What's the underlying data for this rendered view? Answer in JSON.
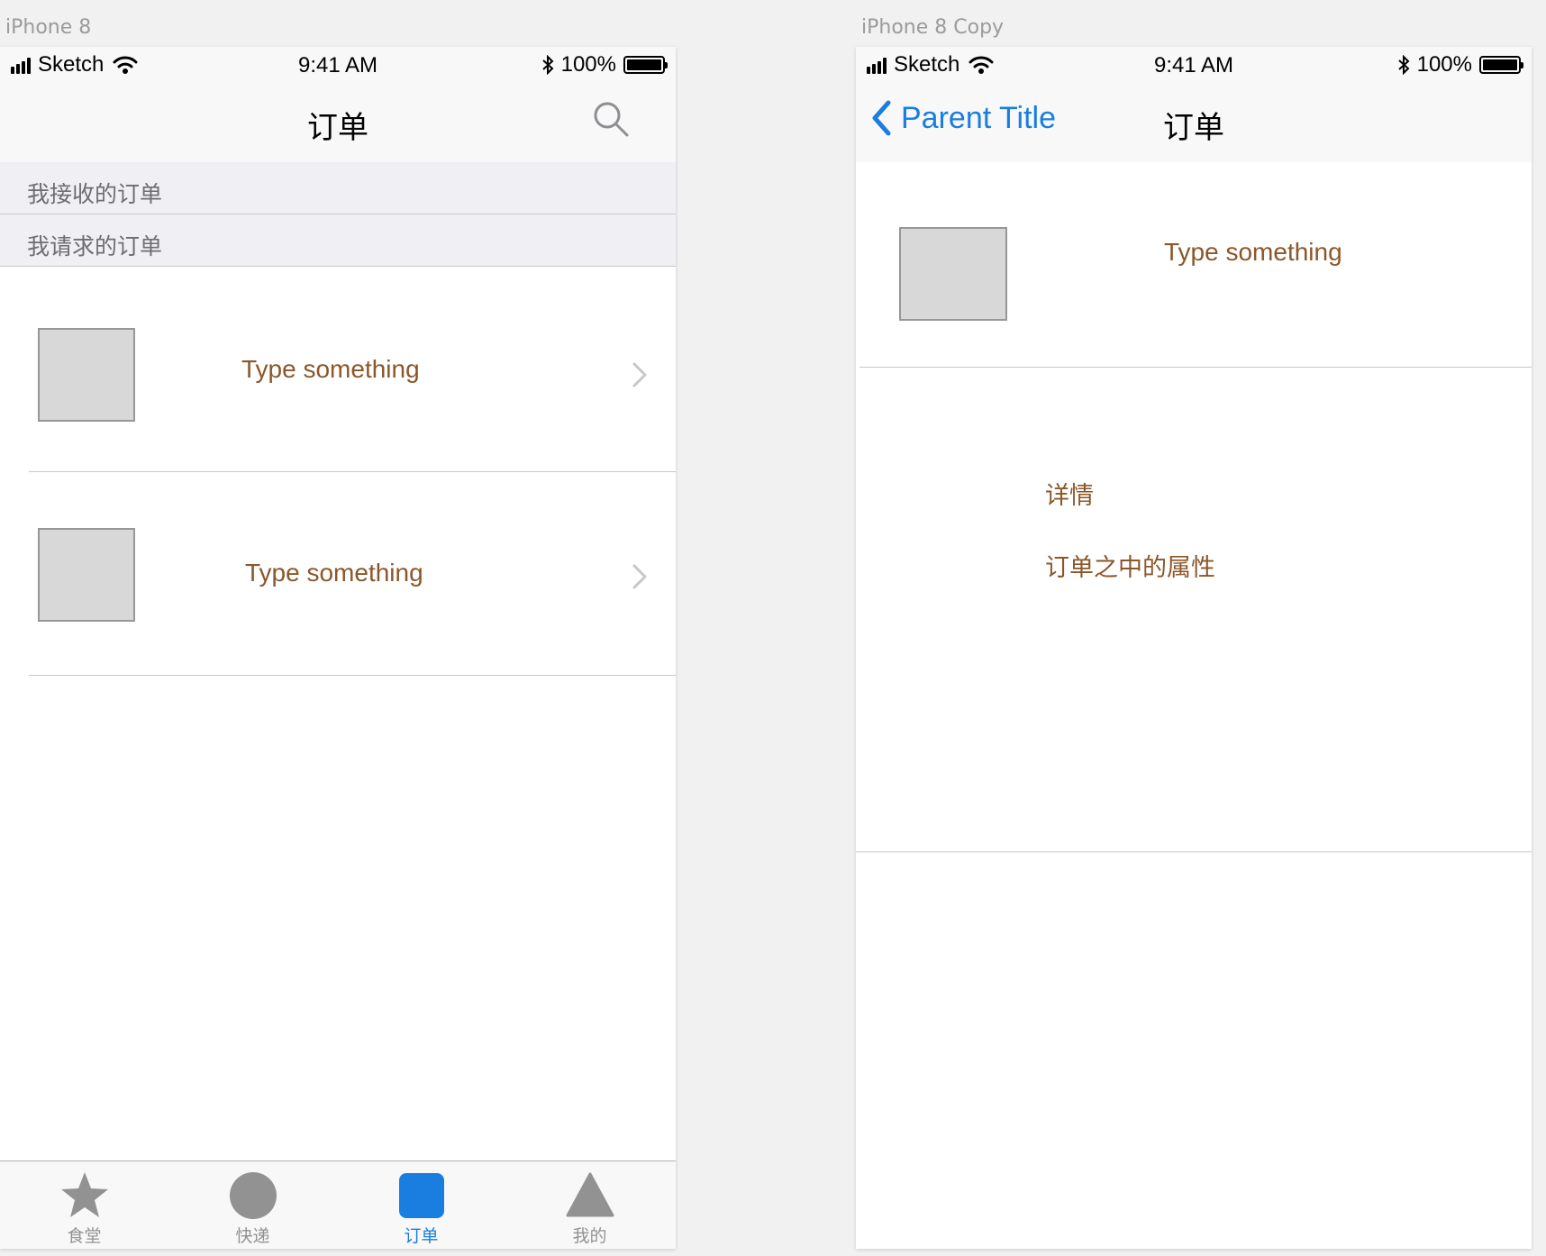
{
  "artboards": [
    {
      "label": "iPhone 8"
    },
    {
      "label": "iPhone 8 Copy"
    }
  ],
  "status_bar": {
    "carrier": "Sketch",
    "time": "9:41 AM",
    "battery_percent": "100%",
    "icons": [
      "signal-bars-icon",
      "wifi-icon",
      "bluetooth-icon",
      "battery-icon"
    ]
  },
  "screen1": {
    "nav_title": "订单",
    "search_icon": "search-icon",
    "sections": [
      {
        "label": "我接收的订单"
      },
      {
        "label": "我请求的订单"
      }
    ],
    "rows": [
      {
        "title": "Type something",
        "icon": "chevron-right-icon"
      },
      {
        "title": "Type something",
        "icon": "chevron-right-icon"
      }
    ],
    "tabs": [
      {
        "label": "食堂",
        "icon": "star-icon",
        "active": false
      },
      {
        "label": "快递",
        "icon": "circle-icon",
        "active": false
      },
      {
        "label": "订单",
        "icon": "square-icon",
        "active": true
      },
      {
        "label": "我的",
        "icon": "triangle-icon",
        "active": false
      }
    ]
  },
  "screen2": {
    "back_label": "Parent Title",
    "back_icon": "chevron-left-icon",
    "nav_title": "订单",
    "row": {
      "title": "Type something"
    },
    "detail": {
      "heading": "详情",
      "attributes": "订单之中的属性"
    }
  },
  "colors": {
    "accent": "#1A7DE0",
    "row_text": "#8B572A",
    "placeholder_fill": "#D8D8D8",
    "tab_inactive": "#929292",
    "section_bg": "#EFEFF4"
  }
}
